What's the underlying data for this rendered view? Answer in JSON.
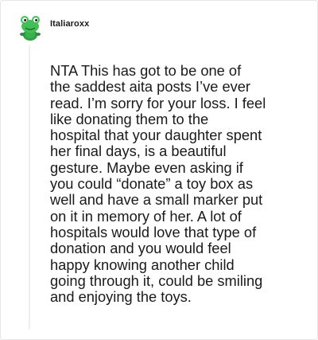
{
  "comment": {
    "username": "Italiaroxx",
    "avatar_icon": "frog-snoo-avatar-icon",
    "body": "NTA This has got to be one of\nthe saddest aita posts I’ve ever\nread. I’m sorry for your loss. I feel\nlike donating them to the\nhospital that your daughter spent\nher final days, is a beautiful\ngesture. Maybe even asking if\nyou could “donate” a toy box as\nwell and have a small marker put\non it in memory of her. A lot of\nhospitals would love that type of\ndonation and you would feel\nhappy knowing another child\ngoing through it, could be smiling\nand enjoying the toys."
  }
}
